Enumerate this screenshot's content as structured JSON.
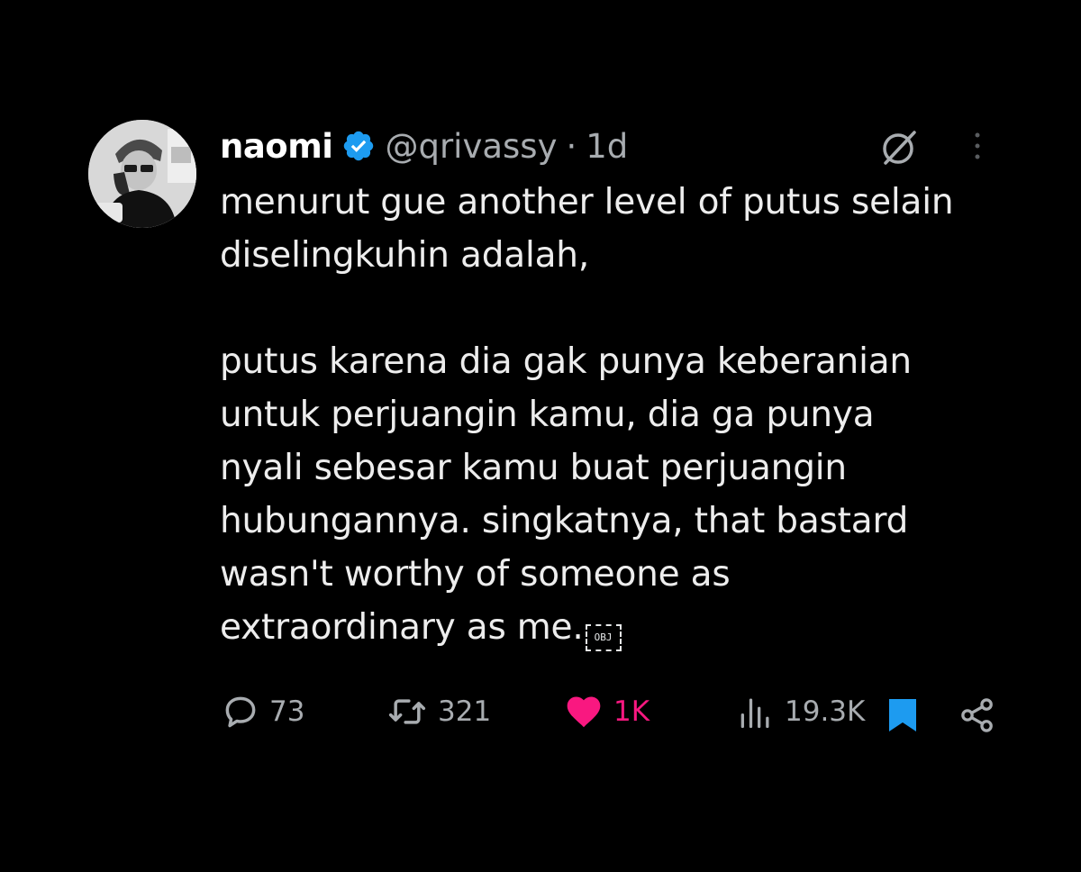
{
  "tweet": {
    "author": {
      "name": "naomi",
      "handle": "@qrivassy",
      "separator": "·",
      "time": "1d",
      "verified_icon": "verified-badge-icon",
      "avatar_icon": "user-avatar"
    },
    "text_before_glyph": "menurut gue another level of putus selain\ndiselingkuhin adalah,\n\nputus karena dia gak punya keberanian\nuntuk perjuangin kamu, dia ga punya\nnyali sebesar kamu buat perjuangin\nhubungannya. singkatnya, that bastard\nwasn't worthy of someone as\nextraordinary as me.",
    "glyph_label": "OBJ",
    "stats": {
      "replies": "73",
      "reposts": "321",
      "likes": "1K",
      "views": "19.3K"
    },
    "icons": {
      "grok": "grok-icon",
      "more": "more-icon",
      "reply": "reply-icon",
      "repost": "repost-icon",
      "like": "heart-icon",
      "views": "views-icon",
      "bookmark": "bookmark-icon",
      "share": "share-icon"
    },
    "colors": {
      "background": "#000000",
      "text": "#e7e9ea",
      "secondary": "#a8acb0",
      "verified": "#1d9bf0",
      "like": "#f91880",
      "bookmark": "#1d9bf0"
    }
  }
}
